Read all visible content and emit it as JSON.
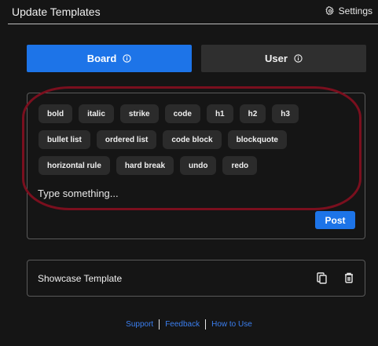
{
  "header": {
    "title": "Update Templates",
    "settings_label": "Settings"
  },
  "tabs": [
    {
      "label": "Board",
      "active": true
    },
    {
      "label": "User",
      "active": false
    }
  ],
  "editor": {
    "toolbar_row1": [
      "bold",
      "italic",
      "strike",
      "code",
      "h1",
      "h2",
      "h3"
    ],
    "toolbar_row2": [
      "bullet list",
      "ordered list",
      "code block",
      "blockquote"
    ],
    "toolbar_row3": [
      "horizontal rule",
      "hard break",
      "undo",
      "redo"
    ],
    "placeholder": "Type something...",
    "post_label": "Post"
  },
  "showcase": {
    "label": "Showcase Template"
  },
  "footer": {
    "links": [
      "Support",
      "Feedback",
      "How to Use"
    ]
  },
  "colors": {
    "accent": "#1d74e8",
    "background": "#151515",
    "highlight": "#7a0f1e",
    "link": "#3b7ff0"
  }
}
